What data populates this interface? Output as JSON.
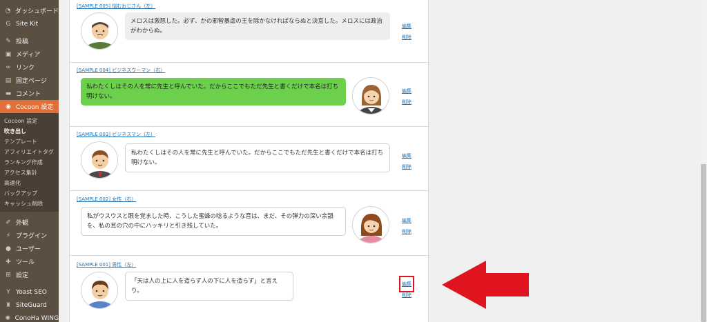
{
  "sidebar": {
    "items": [
      {
        "label": "ダッシュボード",
        "icon": "dashboard-icon"
      },
      {
        "label": "Site Kit",
        "icon": "sitekit-icon"
      },
      {
        "label": "投稿",
        "icon": "pin-icon"
      },
      {
        "label": "メディア",
        "icon": "media-icon"
      },
      {
        "label": "リンク",
        "icon": "link-icon"
      },
      {
        "label": "固定ページ",
        "icon": "page-icon"
      },
      {
        "label": "コメント",
        "icon": "comment-icon"
      },
      {
        "label": "Cocoon 設定",
        "icon": "cocoon-icon"
      }
    ],
    "submenu": [
      "Cocoon 設定",
      "吹き出し",
      "テンプレート",
      "アフィリエイトタグ",
      "ランキング作成",
      "アクセス集計",
      "高速化",
      "バックアップ",
      "キャッシュ削除"
    ],
    "items2": [
      {
        "label": "外観",
        "icon": "brush-icon"
      },
      {
        "label": "プラグイン",
        "icon": "plugin-icon"
      },
      {
        "label": "ユーザー",
        "icon": "user-icon"
      },
      {
        "label": "ツール",
        "icon": "wrench-icon"
      },
      {
        "label": "設定",
        "icon": "settings-icon"
      },
      {
        "label": "Yoast SEO",
        "icon": "yoast-icon"
      },
      {
        "label": "SiteGuard",
        "icon": "siteguard-icon"
      },
      {
        "label": "ConoHa WING",
        "icon": "conoha-icon"
      }
    ]
  },
  "entries": [
    {
      "title": "[SAMPLE 005] 悩むおじさん（左）",
      "text": "メロスは激怒した。必ず、かの邪智暴虐の王を除かなければならぬと決意した。メロスには政治がわからぬ。"
    },
    {
      "title": "[SAMPLE 004] ビジネスウーマン（右）",
      "text": "私わたくしはその人を常に先生と呼んでいた。だからここでもただ先生と書くだけで本名は打ち明けない。"
    },
    {
      "title": "[SAMPLE 003] ビジネスマン（左）",
      "text": "私わたくしはその人を常に先生と呼んでいた。だからここでもただ先生と書くだけで本名は打ち明けない。"
    },
    {
      "title": "[SAMPLE 002] 女性（右）",
      "text": "私がウスウスと眼を覚ました時、こうした蜜蜂の唸るような音は、まだ、その弾力の深い余韻を、私の耳の穴の中にハッキリと引き残していた。"
    },
    {
      "title": "[SAMPLE 001] 男性（左）",
      "text": "「天は人の上に人を造らず人の下に人を造らず」と言えり。"
    }
  ],
  "actions": {
    "edit": "編集",
    "delete": "削除"
  },
  "colors": {
    "sidebar": "#5b4f42",
    "active": "#e0703a",
    "green_bubble": "#6cd04d",
    "arrow": "#e0141e",
    "link": "#2271b1"
  }
}
